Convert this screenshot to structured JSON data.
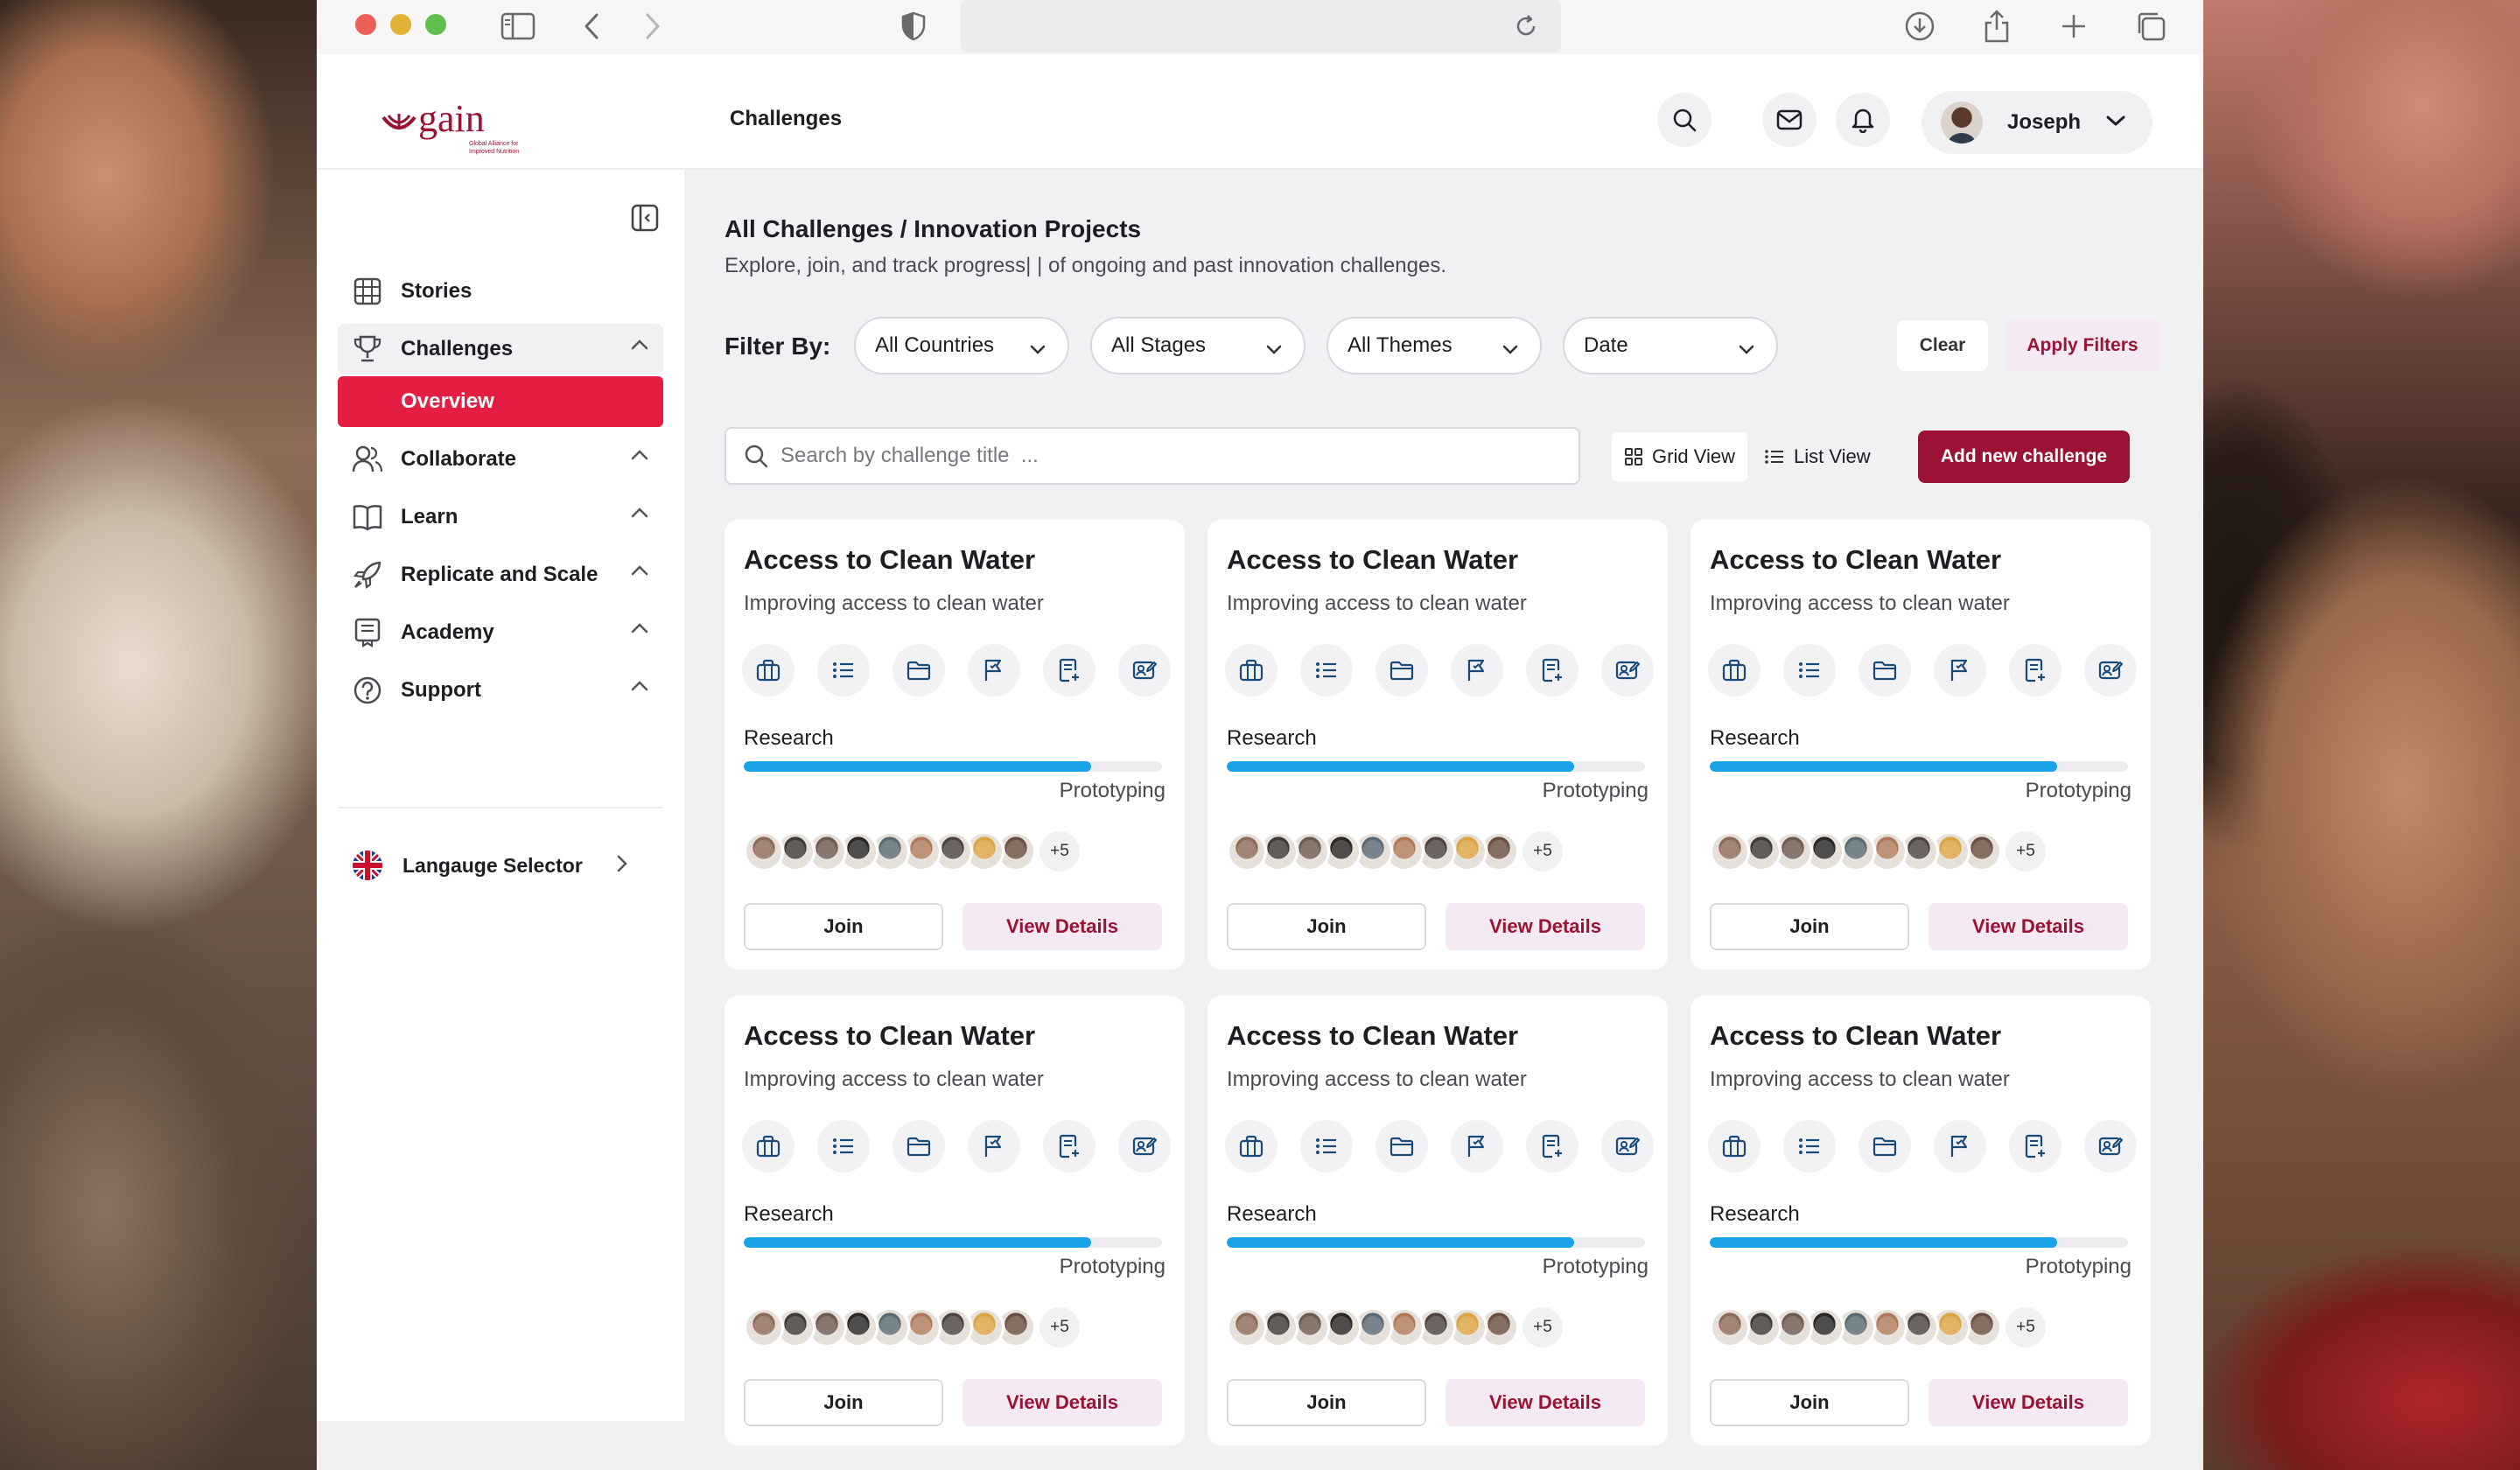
{
  "app": {
    "logo_text": "gain",
    "logo_tagline": "Global Alliance for Improved Nutrition",
    "header_title": "Challenges",
    "user_name": "Joseph"
  },
  "sidebar": {
    "items": [
      {
        "label": "Stories",
        "icon": "grid-icon"
      },
      {
        "label": "Challenges",
        "icon": "trophy-icon",
        "sub": "Overview"
      },
      {
        "label": "Collaborate",
        "icon": "users-icon"
      },
      {
        "label": "Learn",
        "icon": "book-icon"
      },
      {
        "label": "Replicate and Scale",
        "icon": "rocket-icon"
      },
      {
        "label": "Academy",
        "icon": "certificate-icon"
      },
      {
        "label": "Support",
        "icon": "help-icon"
      }
    ],
    "language": "Langauge Selector"
  },
  "page": {
    "title": "All Challenges / Innovation Projects",
    "subtitle": "Explore, join, and track progress| | of ongoing and past innovation challenges."
  },
  "filters": {
    "label": "Filter By:",
    "countries": "All Countries",
    "stages": "All Stages",
    "themes": "All Themes",
    "date": "Date",
    "clear": "Clear",
    "apply": "Apply Filters"
  },
  "toolbar": {
    "search_placeholder": "Search by challenge title  ...",
    "grid_view": "Grid View",
    "list_view": "List View",
    "add": "Add new challenge"
  },
  "cards": [
    {
      "title": "Access to Clean Water",
      "subtitle": "Improving access to clean water",
      "stage_from": "Research",
      "stage_to": "Prototyping",
      "progress": 0.83,
      "more": "+5",
      "join": "Join",
      "details": "View Details"
    },
    {
      "title": "Access to Clean Water",
      "subtitle": "Improving access to clean water",
      "stage_from": "Research",
      "stage_to": "Prototyping",
      "progress": 0.83,
      "more": "+5",
      "join": "Join",
      "details": "View Details"
    },
    {
      "title": "Access to Clean Water",
      "subtitle": "Improving access to clean water",
      "stage_from": "Research",
      "stage_to": "Prototyping",
      "progress": 0.83,
      "more": "+5",
      "join": "Join",
      "details": "View Details"
    },
    {
      "title": "Access to Clean Water",
      "subtitle": "Improving access to clean water",
      "stage_from": "Research",
      "stage_to": "Prototyping",
      "progress": 0.83,
      "more": "+5",
      "join": "Join",
      "details": "View Details"
    },
    {
      "title": "Access to Clean Water",
      "subtitle": "Improving access to clean water",
      "stage_from": "Research",
      "stage_to": "Prototyping",
      "progress": 0.83,
      "more": "+5",
      "join": "Join",
      "details": "View Details"
    },
    {
      "title": "Access to Clean Water",
      "subtitle": "Improving access to clean water",
      "stage_from": "Research",
      "stage_to": "Prototyping",
      "progress": 0.83,
      "more": "+5",
      "join": "Join",
      "details": "View Details"
    }
  ],
  "colors": {
    "brand": "#9b1234",
    "accent": "#e41d42",
    "progress": "#1aa3e8",
    "icon": "#1a4a7a"
  }
}
